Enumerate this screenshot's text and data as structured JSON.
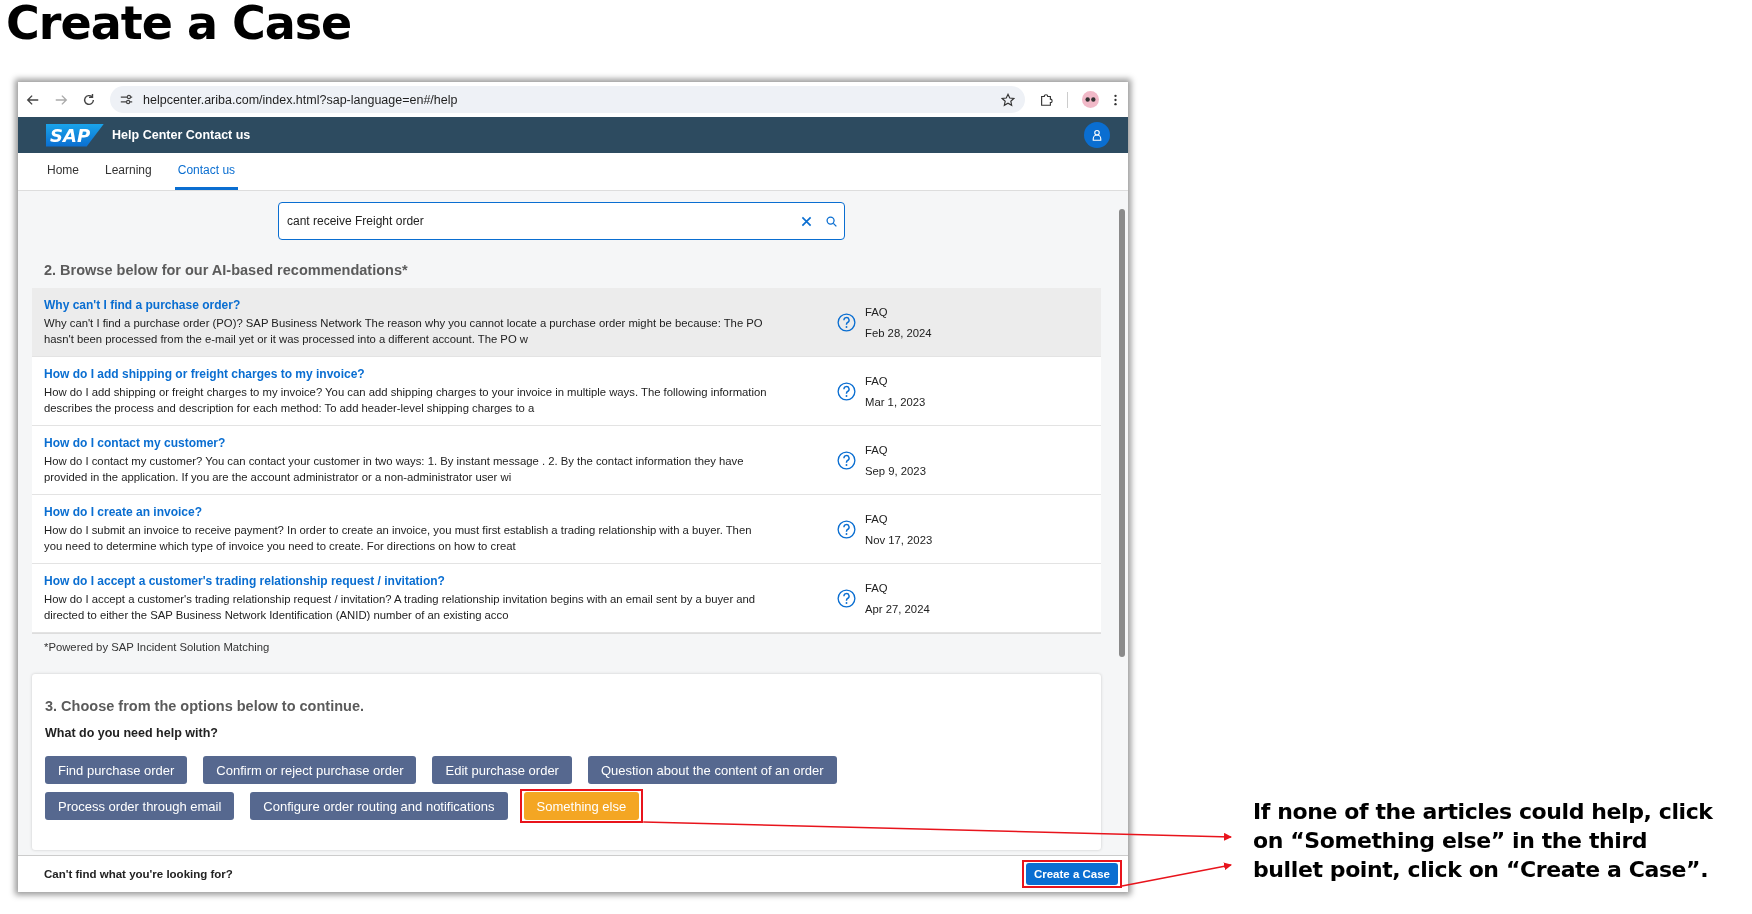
{
  "slide_title": "Create a Case",
  "browser": {
    "url": "helpcenter.ariba.com/index.html?sap-language=en#/help"
  },
  "header": {
    "logo": "SAP",
    "title": "Help Center Contact us"
  },
  "tabs": [
    {
      "label": "Home",
      "selected": false
    },
    {
      "label": "Learning",
      "selected": false
    },
    {
      "label": "Contact us",
      "selected": true
    }
  ],
  "search": {
    "value": "cant receive Freight order"
  },
  "recommendations": {
    "heading": "2. Browse below for our AI-based recommendations*",
    "items": [
      {
        "title": "Why can't I find a purchase order?",
        "snippet": "Why can't I find a purchase order (PO)? SAP Business Network The reason why you cannot locate a purchase order might be because: The PO hasn't been processed from the e-mail yet or it was processed into a different account. The PO w",
        "type": "FAQ",
        "date": "Feb 28, 2024",
        "highlighted": true
      },
      {
        "title": "How do I add shipping or freight charges to my invoice?",
        "snippet": "How do I add shipping or freight charges to my invoice? You can add shipping charges to your invoice in multiple ways. The following information describes the process and description for each method: To add header-level shipping charges to a",
        "type": "FAQ",
        "date": "Mar 1, 2023",
        "highlighted": false
      },
      {
        "title": "How do I contact my customer?",
        "snippet": "How do I contact my customer? You can contact your customer in two ways: 1. By instant message . 2. By the contact information they have provided in the application. If you are the account administrator or a non-administrator user wi",
        "type": "FAQ",
        "date": "Sep 9, 2023",
        "highlighted": false
      },
      {
        "title": "How do I create an invoice?",
        "snippet": "How do I submit an invoice to receive payment? In order to create an invoice, you must first establish a trading relationship with a buyer. Then you need to determine which type of invoice you need to create. For directions on how to creat",
        "type": "FAQ",
        "date": "Nov 17, 2023",
        "highlighted": false
      },
      {
        "title": "How do I accept a customer's trading relationship request / invitation?",
        "snippet": "How do I accept a customer's trading relationship request / invitation? A trading relationship invitation begins with an email sent by a buyer and directed to either the SAP Business Network Identification (ANID) number of an existing acco",
        "type": "FAQ",
        "date": "Apr 27, 2024",
        "highlighted": false
      }
    ],
    "footnote": "*Powered by SAP Incident Solution Matching"
  },
  "options": {
    "heading": "3. Choose from the options below to continue.",
    "question": "What do you need help with?",
    "buttons": [
      {
        "label": "Find purchase order",
        "highlighted": false
      },
      {
        "label": "Confirm or reject purchase order",
        "highlighted": false
      },
      {
        "label": "Edit purchase order",
        "highlighted": false
      },
      {
        "label": "Question about the content of an order",
        "highlighted": false
      },
      {
        "label": "Process order through email",
        "highlighted": false
      },
      {
        "label": "Configure order routing and notifications",
        "highlighted": false
      },
      {
        "label": "Something else",
        "highlighted": true
      }
    ]
  },
  "footer": {
    "text": "Can't find what you're looking for?",
    "button": "Create a Case",
    "highlighted": true
  },
  "annotation": "If none of the articles could help, click on “Something else” in the third bullet point, click on “Create a Case”."
}
